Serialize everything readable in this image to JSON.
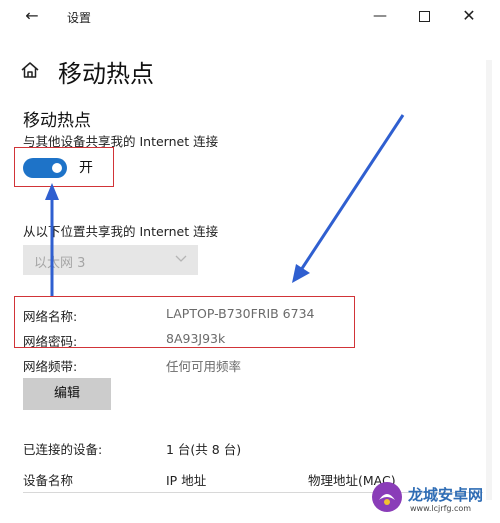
{
  "window": {
    "title": "设置"
  },
  "page": {
    "title": "移动热点"
  },
  "hotspot": {
    "section_title": "移动热点",
    "share_label": "与其他设备共享我的 Internet 连接",
    "toggle_state": "开",
    "from_label": "从以下位置共享我的 Internet 连接",
    "source_selected": "以太网 3"
  },
  "network": {
    "name_label": "网络名称:",
    "name_value": "LAPTOP-B730FRIB 6734",
    "password_label": "网络密码:",
    "password_value": "8A93J93k",
    "band_label": "网络频带:",
    "band_value": "任何可用频率",
    "edit_label": "编辑"
  },
  "devices": {
    "connected_label": "已连接的设备:",
    "connected_value": "1 台(共 8 台)",
    "columns": [
      "设备名称",
      "IP 地址",
      "物理地址(MAC)"
    ]
  },
  "watermark": {
    "brand": "龙城安卓网",
    "url": "www.lcjrfg.com"
  },
  "colors": {
    "accent": "#1e73c8",
    "highlight": "#d13438",
    "arrow": "#2f5fd0"
  }
}
